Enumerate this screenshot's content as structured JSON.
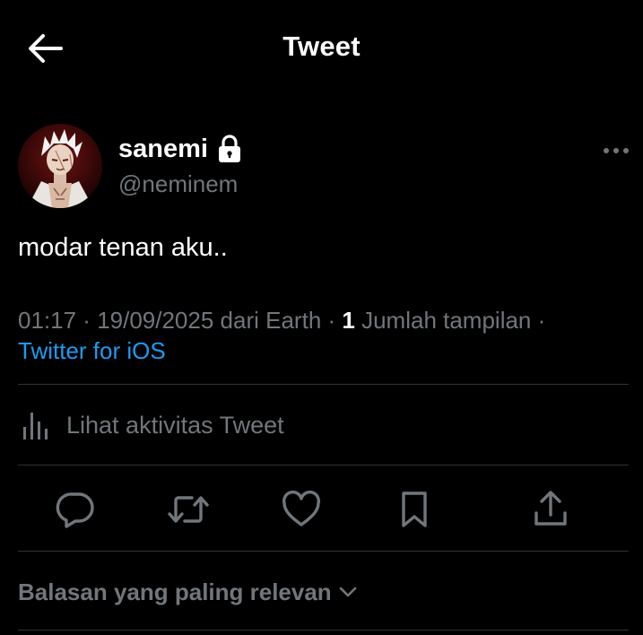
{
  "header": {
    "title": "Tweet",
    "back_icon": "arrow-left-icon"
  },
  "author": {
    "display_name": "sanemi",
    "username": "@neminem",
    "protected_icon": "lock-icon",
    "more_icon": "more-horizontal-icon"
  },
  "tweet": {
    "text": "modar tenan aku.."
  },
  "meta": {
    "time": "01:17",
    "separator": " · ",
    "date": "19/09/2025",
    "location": " dari Earth",
    "views_count": "1",
    "views_label": " Jumlah tampilan",
    "source": "Twitter for iOS"
  },
  "activity": {
    "label": "Lihat aktivitas Tweet",
    "icon": "bar-chart-icon"
  },
  "actions": [
    {
      "name": "reply",
      "icon": "speech-bubble-icon"
    },
    {
      "name": "retweet",
      "icon": "retweet-icon"
    },
    {
      "name": "like",
      "icon": "heart-icon"
    },
    {
      "name": "bookmark",
      "icon": "bookmark-icon"
    },
    {
      "name": "share",
      "icon": "share-upload-icon"
    }
  ],
  "replies": {
    "sort_label": "Balasan yang paling relevan",
    "chevron_icon": "chevron-down-icon"
  },
  "colors": {
    "background": "#000000",
    "primary_text": "#ffffff",
    "secondary_text": "#71767b",
    "link": "#1d9bf0",
    "divider": "#2f3336"
  }
}
